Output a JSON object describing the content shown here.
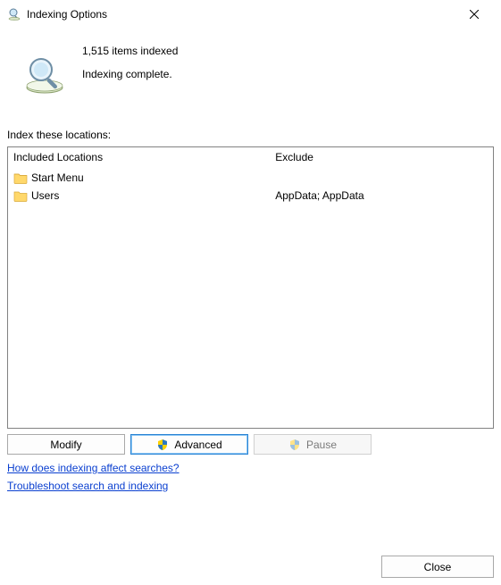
{
  "window": {
    "title": "Indexing Options"
  },
  "status": {
    "line1": "1,515 items indexed",
    "line2": "Indexing complete."
  },
  "locations": {
    "section_label": "Index these locations:",
    "col_included_header": "Included Locations",
    "col_exclude_header": "Exclude",
    "rows": [
      {
        "name": "Start Menu",
        "exclude": ""
      },
      {
        "name": "Users",
        "exclude": "AppData; AppData"
      }
    ]
  },
  "buttons": {
    "modify": "Modify",
    "advanced": "Advanced",
    "pause": "Pause",
    "close": "Close"
  },
  "links": {
    "help": "How does indexing affect searches?",
    "troubleshoot": "Troubleshoot search and indexing"
  }
}
